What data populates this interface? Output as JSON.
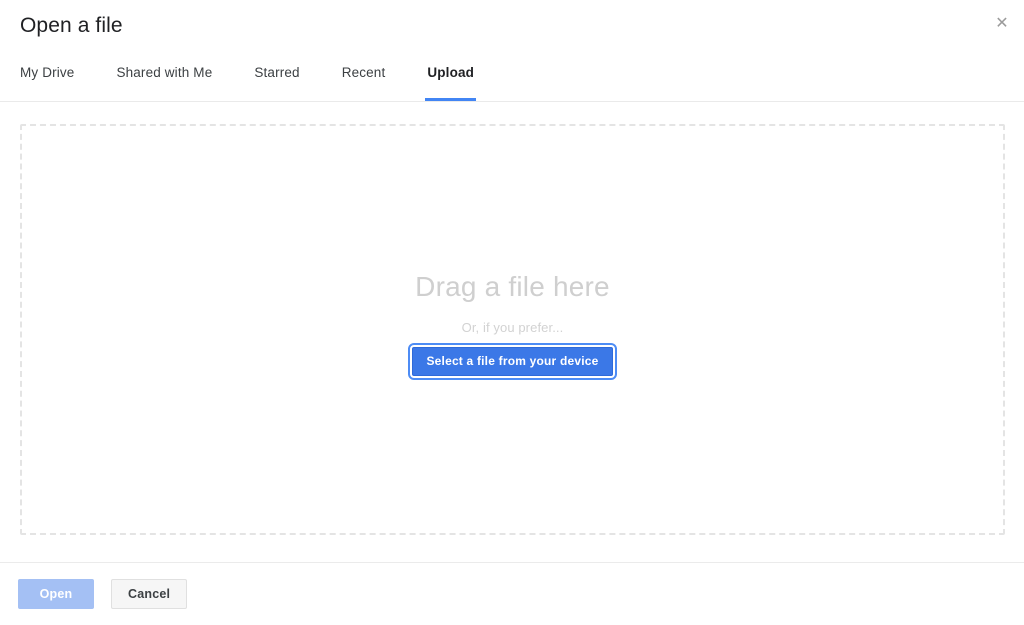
{
  "dialog": {
    "title": "Open a file",
    "close_icon": "close-icon",
    "close_label": "✕"
  },
  "tabs": [
    {
      "label": "My Drive",
      "active": false
    },
    {
      "label": "Shared with Me",
      "active": false
    },
    {
      "label": "Starred",
      "active": false
    },
    {
      "label": "Recent",
      "active": false
    },
    {
      "label": "Upload",
      "active": true
    }
  ],
  "dropzone": {
    "headline": "Drag a file here",
    "subtext": "Or, if you prefer...",
    "select_button_label": "Select a file from your device"
  },
  "footer": {
    "open_label": "Open",
    "cancel_label": "Cancel"
  },
  "colors": {
    "accent_blue": "#4285f4",
    "button_blue": "#3b78e7",
    "disabled_blue": "#a4c0f4",
    "cancel_gray": "#f6f6f6",
    "placeholder_gray": "#cfcfcf",
    "dash_gray": "#e4e4e4"
  }
}
